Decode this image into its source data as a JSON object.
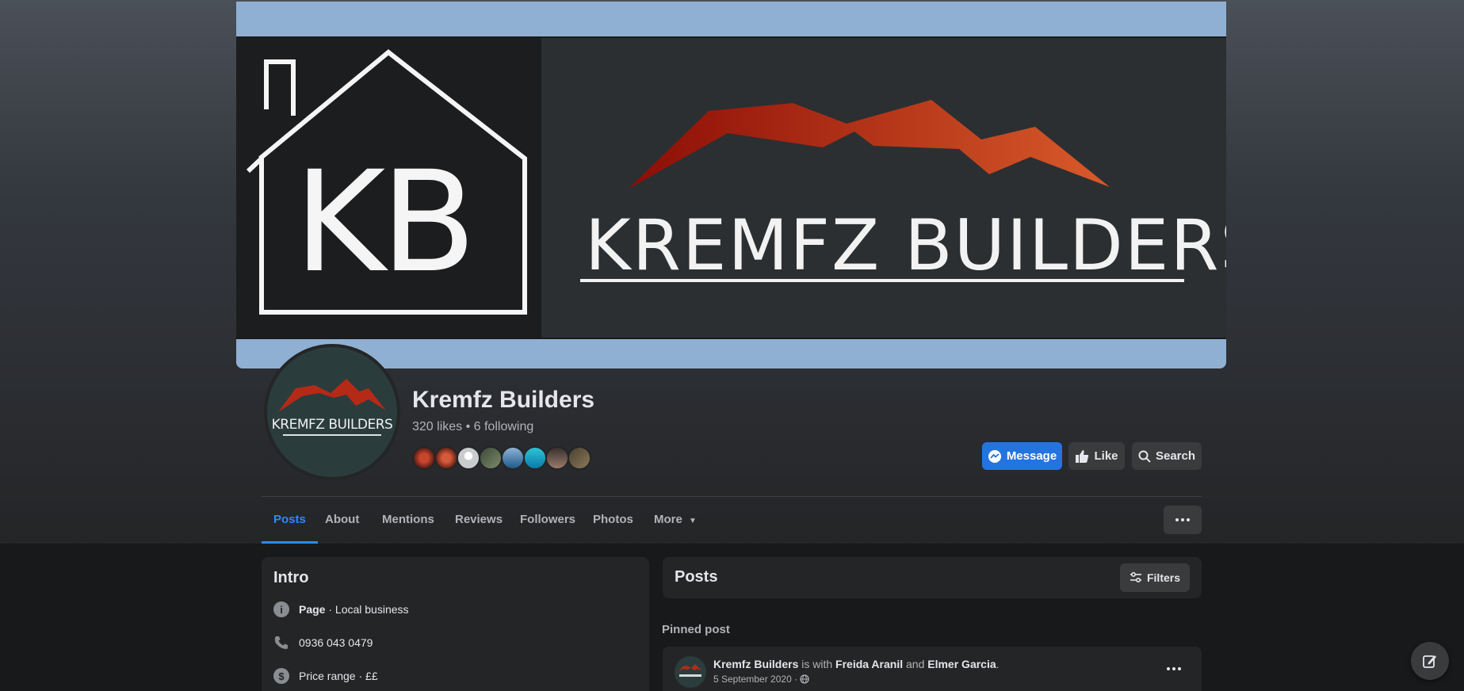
{
  "cover": {
    "kb_text": "KB",
    "brand_text": "KREMFZ BUILDERS"
  },
  "profile": {
    "logo_text": "KREMFZ BUILDERS",
    "name": "Kremfz Builders",
    "stats": "320 likes • 6 following"
  },
  "actions": {
    "message": "Message",
    "like": "Like",
    "search": "Search"
  },
  "tabs": [
    {
      "label": "Posts"
    },
    {
      "label": "About"
    },
    {
      "label": "Mentions"
    },
    {
      "label": "Reviews"
    },
    {
      "label": "Followers"
    },
    {
      "label": "Photos"
    },
    {
      "label": "More"
    }
  ],
  "intro": {
    "title": "Intro",
    "page_type_bold": "Page",
    "page_type_rest": " · Local business",
    "phone": "0936 043 0479",
    "price_range": "Price range · ££"
  },
  "posts": {
    "title": "Posts",
    "filters_label": "Filters",
    "pinned_label": "Pinned post",
    "pinned": {
      "author": "Kremfz Builders",
      "is_with": " is with ",
      "tag1": "Freida Aranil",
      "and": " and ",
      "tag2": "Elmer Garcia",
      "end": ".",
      "date": "5 September 2020 ·"
    }
  },
  "colors": {
    "accent": "#2d88ff",
    "primary_button": "#2374e1",
    "card_bg": "#242526",
    "page_bg": "#18191a"
  },
  "icons": {
    "message": "messenger-icon",
    "like": "thumbs-up-icon",
    "search": "search-icon",
    "info": "info-icon",
    "phone": "phone-icon",
    "price": "dollar-icon",
    "filters": "sliders-icon",
    "privacy": "globe-icon",
    "compose": "edit-icon"
  }
}
